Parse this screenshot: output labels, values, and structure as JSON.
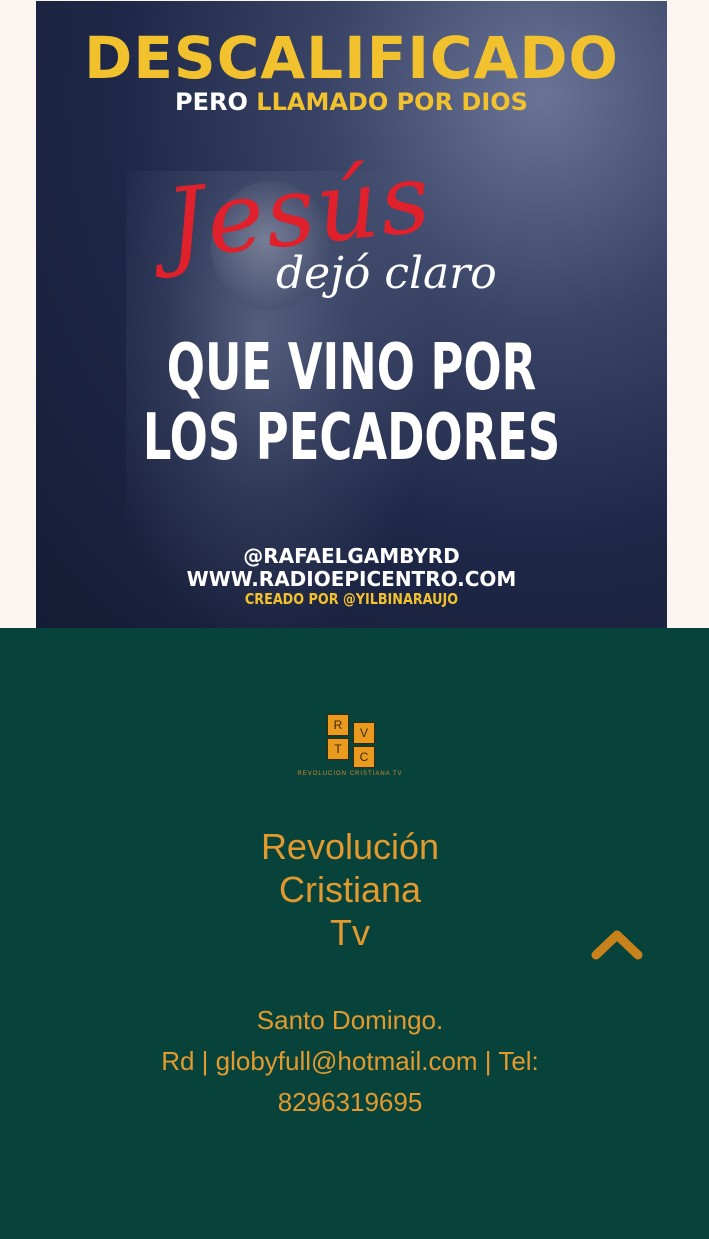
{
  "poster": {
    "title": "DESCALIFICADO",
    "subtitle_white": "PERO",
    "subtitle_yellow": "LLAMADO POR DIOS",
    "script_red": "Jesús",
    "script_white": "dejó claro",
    "headline_line1": "QUE VINO POR",
    "headline_line2": "LOS PECADORES",
    "handle": "@RAFAELGAMBYRD",
    "website": "WWW.RADIOEPICENTRO.COM",
    "credit": "CREADO POR @YILBINARAUJO"
  },
  "logo": {
    "letters": [
      "R",
      "V",
      "T",
      "C"
    ],
    "caption": "REVOLUCION CRISTIANA TV"
  },
  "brand": {
    "line1": "Revolución",
    "line2": "Cristiana",
    "line3": "Tv"
  },
  "contact": {
    "line1": "Santo Domingo.",
    "line2": "Rd | globyfull@hotmail.com |  Tel:",
    "line3": "8296319695"
  },
  "scroll_top": {
    "icon": "chevron-up-icon"
  },
  "colors": {
    "footer_bg": "#08433b",
    "accent": "#e29a2f",
    "poster_yellow": "#f2c12e",
    "poster_red": "#e0202a"
  }
}
